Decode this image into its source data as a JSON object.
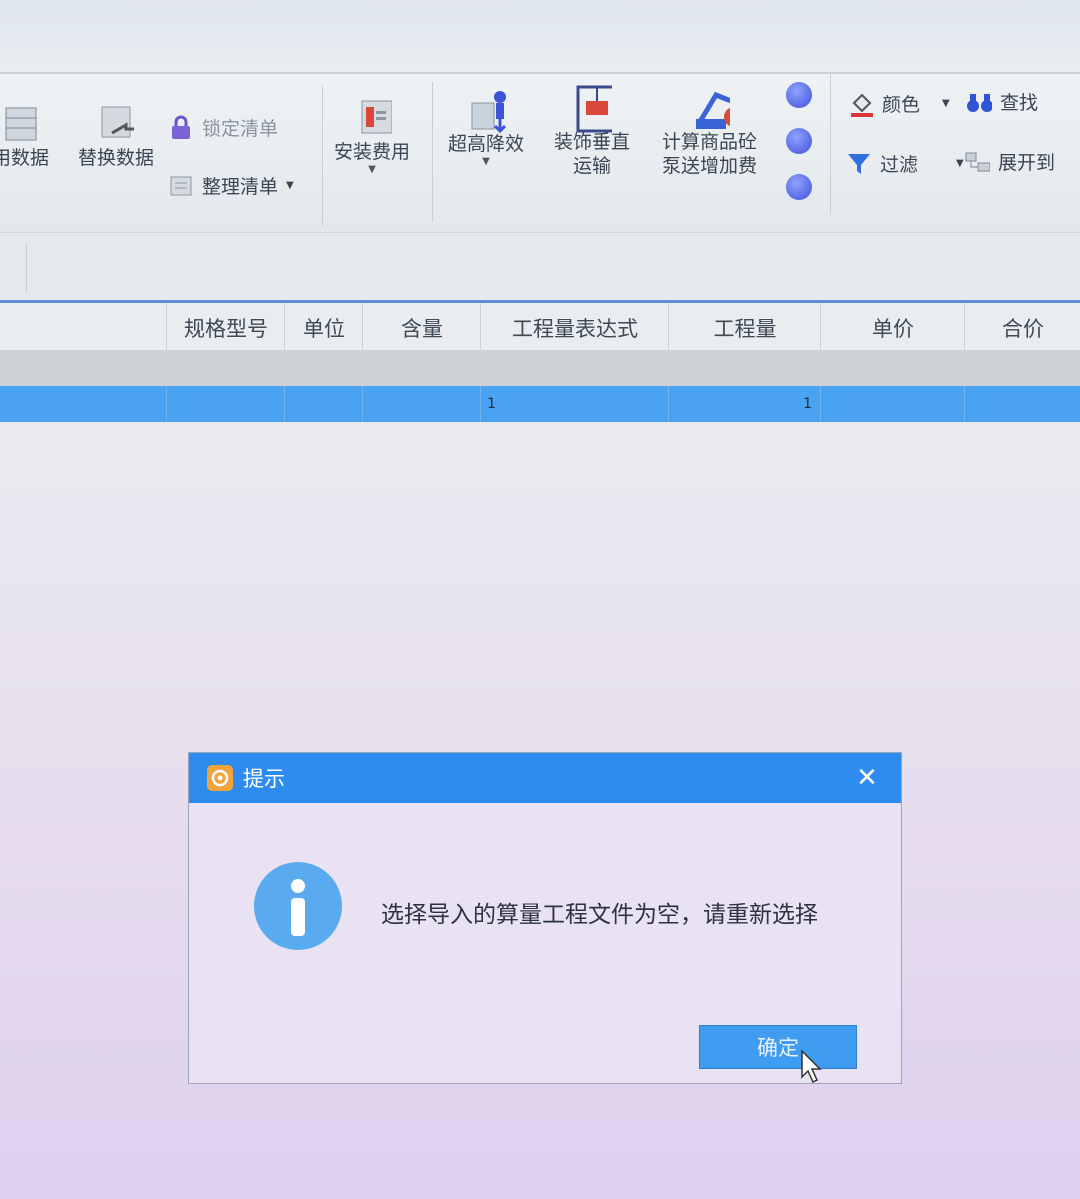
{
  "ribbon": {
    "partial_left": "用数据",
    "replace_data": "替换数据",
    "lock_list": "锁定清单",
    "organize_list": "整理清单",
    "install_fee": "安装费用",
    "raise_efficiency": "超高降效",
    "decor_vertical_line1": "装饰垂直",
    "decor_vertical_line2": "运输",
    "calc_concrete_line1": "计算商品砼",
    "calc_concrete_line2": "泵送增加费",
    "color": "颜色",
    "find": "查找",
    "filter": "过滤",
    "expand_to": "展开到"
  },
  "table": {
    "headers": [
      "规格型号",
      "单位",
      "含量",
      "工程量表达式",
      "工程量",
      "单价",
      "合价"
    ],
    "selected_row": {
      "expression": "1",
      "quantity": "1"
    }
  },
  "dialog": {
    "title": "提示",
    "message": "选择导入的算量工程文件为空，请重新选择",
    "ok_label": "确定",
    "close_icon": "close-icon",
    "info_icon": "info-icon"
  },
  "colors": {
    "title_bar": "#2e8bef",
    "selected_row": "#4aa3f2",
    "ok_button": "#3f9cf0",
    "info_icon": "#5aaaf0"
  }
}
